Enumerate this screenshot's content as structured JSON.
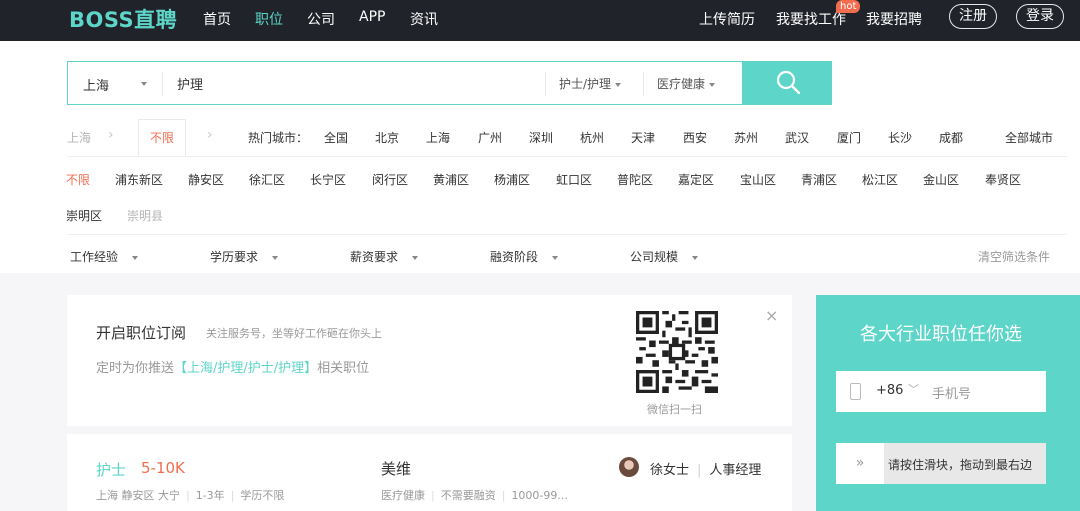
{
  "nav": {
    "logo": "BOSS直聘",
    "links": [
      "首页",
      "职位",
      "公司",
      "APP",
      "资讯"
    ],
    "right": {
      "upload": "上传简历",
      "find_job": "我要找工作",
      "hot": "hot",
      "hire": "我要招聘",
      "register": "注册",
      "login": "登录"
    }
  },
  "search": {
    "city": "上海",
    "query": "护理",
    "category": "护士/护理",
    "industry": "医疗健康"
  },
  "city_row": {
    "current": "上海",
    "unlimited": "不限",
    "hot_label": "热门城市：",
    "cities": [
      "全国",
      "北京",
      "上海",
      "广州",
      "深圳",
      "杭州",
      "天津",
      "西安",
      "苏州",
      "武汉",
      "厦门",
      "长沙",
      "成都"
    ],
    "all_cities": "全部城市"
  },
  "district_row": {
    "unlimited": "不限",
    "districts": [
      "浦东新区",
      "静安区",
      "徐汇区",
      "长宁区",
      "闵行区",
      "黄浦区",
      "杨浦区",
      "虹口区",
      "普陀区",
      "嘉定区",
      "宝山区",
      "青浦区",
      "松江区",
      "金山区",
      "奉贤区"
    ],
    "districts2": [
      "崇明区",
      "崇明县"
    ]
  },
  "conditions": {
    "items": [
      "工作经验",
      "学历要求",
      "薪资要求",
      "融资阶段",
      "公司规模"
    ],
    "clear": "清空筛选条件"
  },
  "subscribe": {
    "title": "开启职位订阅",
    "desc": "关注服务号，坐等好工作砸在你头上",
    "push_prefix": "定时为你推送",
    "push_highlight": "【上海/护理/护士/护理】",
    "push_suffix": "相关职位",
    "qr_caption": "微信扫一扫",
    "close": "×"
  },
  "job": {
    "name": "护士",
    "salary": "5-10K",
    "location": "上海 静安区 大宁",
    "experience": "1-3年",
    "education": "学历不限",
    "company": "美维",
    "industry": "医疗健康",
    "funding": "不需要融资",
    "size": "1000-99...",
    "recruiter": "徐女士",
    "recruiter_title": "人事经理"
  },
  "side": {
    "title": "各大行业职位任你选",
    "country_code": "+86",
    "phone_placeholder": "手机号",
    "slider_handle": "»",
    "slider_text": "请按住滑块，拖动到最右边"
  }
}
